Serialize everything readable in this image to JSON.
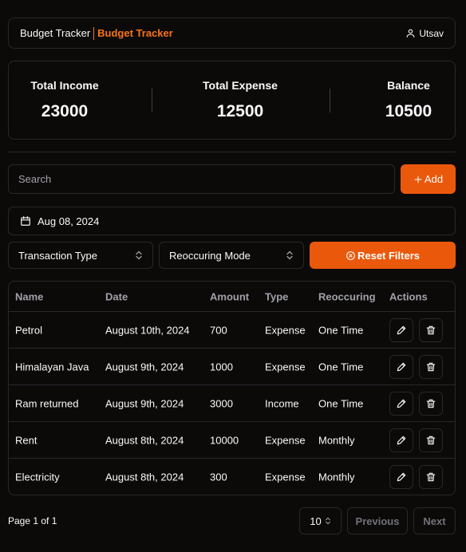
{
  "header": {
    "brand_primary": "Budget Tracker",
    "brand_accent": "Budget Tracker",
    "user_name": "Utsav"
  },
  "stats": {
    "income_label": "Total Income",
    "income_value": "23000",
    "expense_label": "Total Expense",
    "expense_value": "12500",
    "balance_label": "Balance",
    "balance_value": "10500"
  },
  "toolbar": {
    "search_placeholder": "Search",
    "add_label": "Add",
    "date_value": "Aug 08, 2024",
    "type_filter": "Transaction Type",
    "mode_filter": "Reoccuring Mode",
    "reset_label": "Reset Filters"
  },
  "table": {
    "headers": [
      "Name",
      "Date",
      "Amount",
      "Type",
      "Reoccuring",
      "Actions"
    ],
    "rows": [
      [
        "Petrol",
        "August 10th, 2024",
        "700",
        "Expense",
        "One Time"
      ],
      [
        "Himalayan Java",
        "August 9th, 2024",
        "1000",
        "Expense",
        "One Time"
      ],
      [
        "Ram returned",
        "August 9th, 2024",
        "3000",
        "Income",
        "One Time"
      ],
      [
        "Rent",
        "August 8th, 2024",
        "10000",
        "Expense",
        "Monthly"
      ],
      [
        "Electricity",
        "August 8th, 2024",
        "300",
        "Expense",
        "Monthly"
      ]
    ]
  },
  "pagination": {
    "info": "Page 1 of 1",
    "page_size": "10",
    "prev_label": "Previous",
    "next_label": "Next"
  },
  "colors": {
    "accent": "#ea580c",
    "background": "#0c0a09",
    "border": "#27272a"
  }
}
